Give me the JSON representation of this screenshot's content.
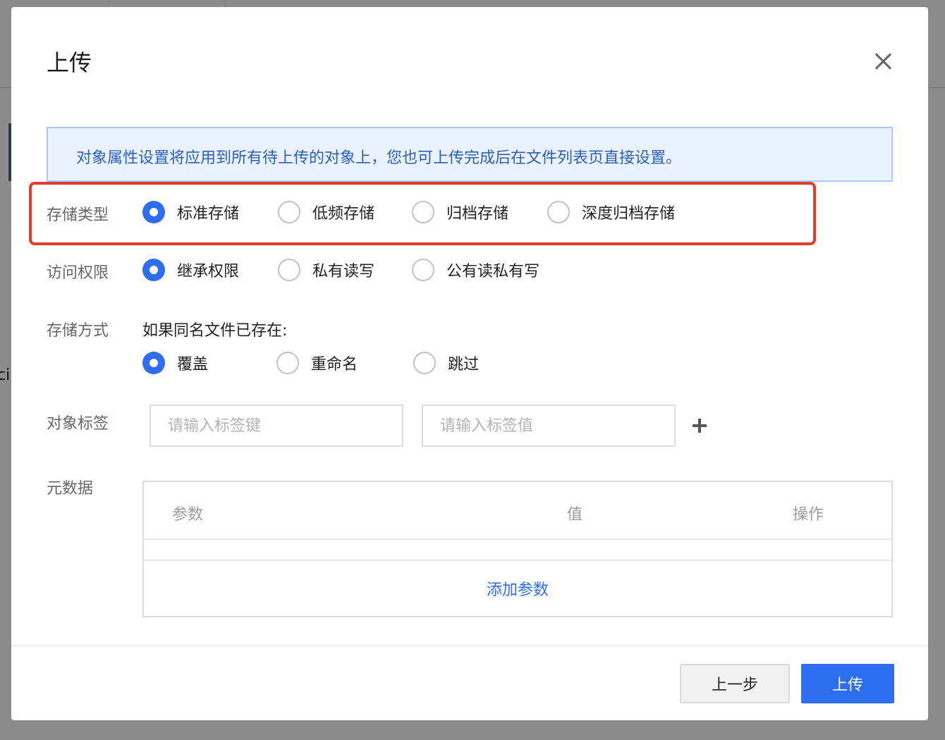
{
  "background": {
    "partial_text": "ci"
  },
  "modal": {
    "title": "上传",
    "notice": "对象属性设置将应用到所有待上传的对象上，您也可上传完成后在文件列表页直接设置。",
    "storage_type": {
      "label": "存储类型",
      "options": [
        "标准存储",
        "低频存储",
        "归档存储",
        "深度归档存储"
      ],
      "selected": "标准存储"
    },
    "access": {
      "label": "访问权限",
      "options": [
        "继承权限",
        "私有读写",
        "公有读私有写"
      ],
      "selected": "继承权限"
    },
    "storage_mode": {
      "label": "存储方式",
      "prompt": "如果同名文件已存在:",
      "options": [
        "覆盖",
        "重命名",
        "跳过"
      ],
      "selected": "覆盖"
    },
    "tags": {
      "label": "对象标签",
      "key_placeholder": "请输入标签键",
      "value_placeholder": "请输入标签值"
    },
    "metadata": {
      "label": "元数据",
      "columns": [
        "参数",
        "值",
        "操作"
      ],
      "add_label": "添加参数"
    },
    "footer": {
      "prev_label": "上一步",
      "upload_label": "上传"
    }
  },
  "colors": {
    "accent": "#2e6cf0",
    "highlight": "#e23b2e",
    "notice_bg": "#eaf2ff"
  },
  "icons": {
    "close": "close-icon",
    "add_tag": "plus-icon"
  }
}
